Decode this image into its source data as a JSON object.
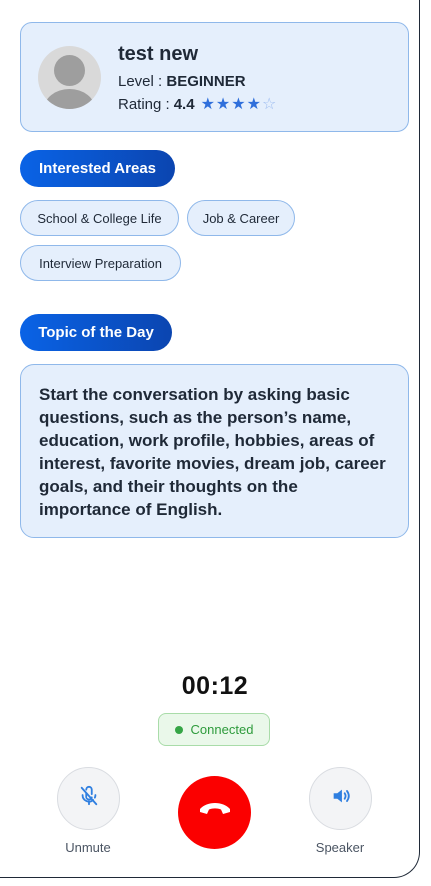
{
  "profile": {
    "name": "test new",
    "level_label": "Level : ",
    "level_value": "BEGINNER",
    "rating_label": "Rating : ",
    "rating_value": "4.4",
    "stars_filled": 4,
    "stars_total": 5
  },
  "interests": {
    "title": "Interested Areas",
    "chips": [
      "School & College Life",
      "Job & Career",
      "Interview Preparation"
    ]
  },
  "topic": {
    "title": "Topic of the Day",
    "text": "Start the conversation by asking basic questions, such as the person’s name, education, work profile, hobbies, areas of interest, favorite movies, dream job, career goals, and their thoughts on the importance of English."
  },
  "call": {
    "timer": "00:12",
    "status": "Connected",
    "mute_label": "Unmute",
    "speaker_label": "Speaker"
  },
  "colors": {
    "accent": "#0a63e6",
    "end_call": "#fb0000",
    "connected": "#2e9b3c"
  }
}
